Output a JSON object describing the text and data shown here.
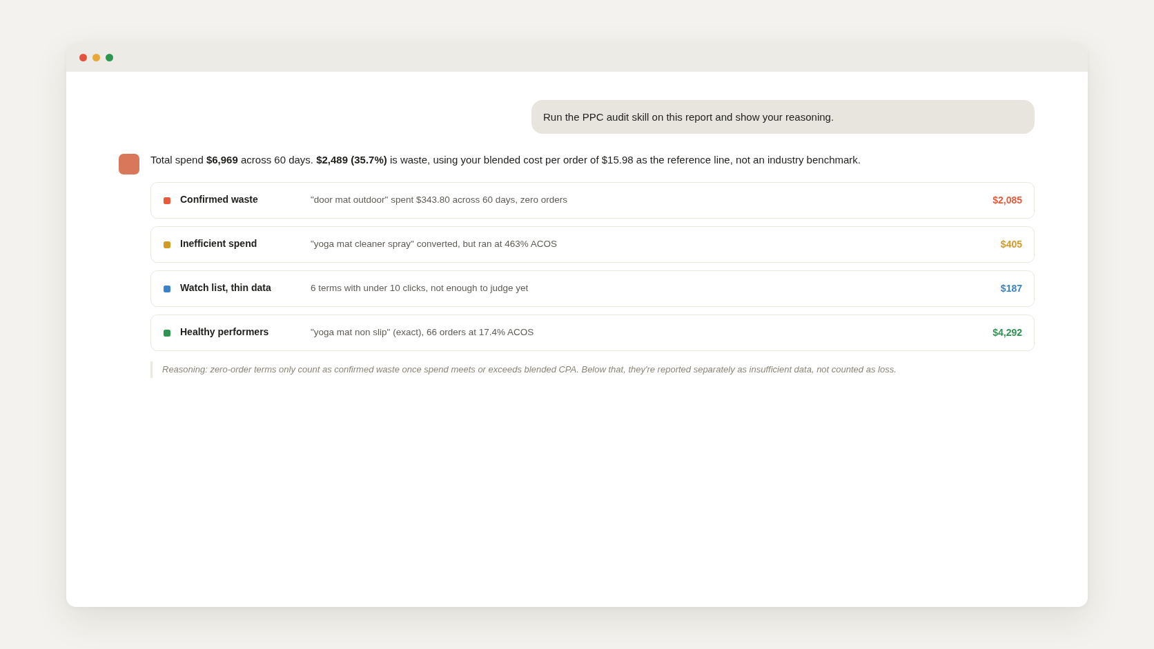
{
  "user_message": {
    "text": "Run the PPC audit skill on this report and show your reasoning."
  },
  "assistant_message": {
    "summary": "Total spend **$6,969** across 60 days. **$2,489 (35.7%)** is waste, using your blended cost per order of $15.98 as the reference line, not an industry benchmark.",
    "categories": [
      {
        "label": "Confirmed waste",
        "description": "\"door mat outdoor\" spent $343.80 across 60 days, zero orders",
        "amount": "$2,085",
        "color": "#e85a3a"
      },
      {
        "label": "Inefficient spend",
        "description": "\"yoga mat cleaner spray\" converted, but ran at 463% ACOS",
        "amount": "$405",
        "color": "#d49a26"
      },
      {
        "label": "Watch list, thin data",
        "description": "6 terms with under 10 clicks, not enough to judge yet",
        "amount": "$187",
        "color": "#3b82c9"
      },
      {
        "label": "Healthy performers",
        "description": "\"yoga mat non slip\" (exact), 66 orders at 17.4% ACOS",
        "amount": "$4,292",
        "color": "#2f9452"
      }
    ],
    "reasoning": "Reasoning: zero-order terms only count as confirmed waste once spend meets or exceeds blended CPA. Below that, they're reported separately as insufficient data, not counted as loss."
  }
}
